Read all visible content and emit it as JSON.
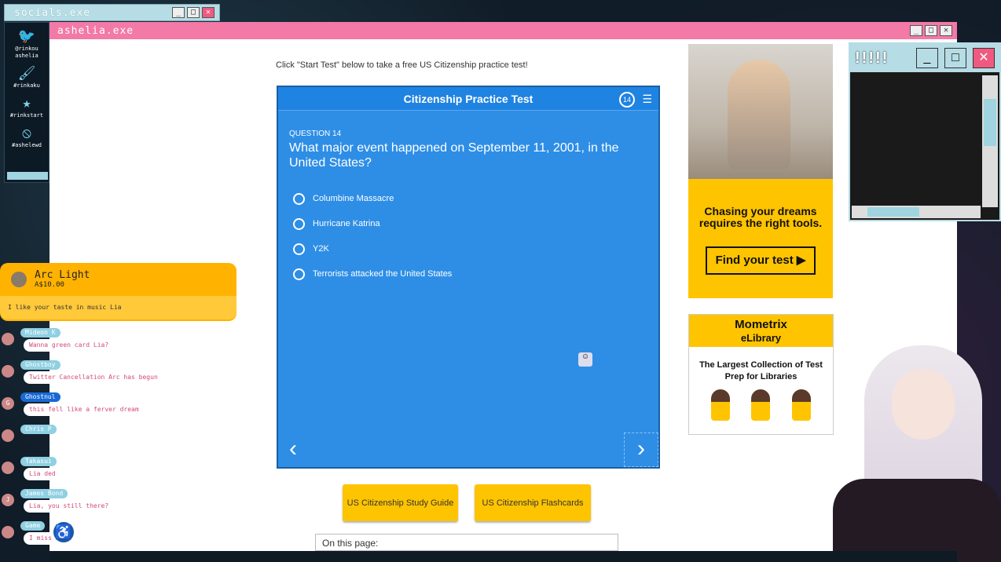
{
  "socials_window": {
    "title": "socials.exe",
    "items": [
      {
        "icon": "twitter-bird-icon",
        "glyph": "🐦",
        "label": "@rinkou\nashelia"
      },
      {
        "icon": "paintbrush-icon",
        "glyph": "🖌",
        "label": "#rinkaku"
      },
      {
        "icon": "star-icon",
        "glyph": "★",
        "label": "#rinkstart"
      },
      {
        "icon": "ban-icon",
        "glyph": "⦸",
        "label": "#ashelewd"
      }
    ]
  },
  "main_window": {
    "title": "ashelia.exe"
  },
  "page": {
    "intro": "Click \"Start Test\" below to take a free US Citizenship practice test!",
    "quiz": {
      "title": "Citizenship Practice Test",
      "question_number": "14",
      "question_label": "QUESTION 14",
      "question_text": "What major event happened on September 11, 2001, in the United States?",
      "answers": [
        "Columbine Massacre",
        "Hurricane Katrina",
        "Y2K",
        "Terrorists attacked the United States"
      ]
    },
    "buttons": {
      "study_guide": "US Citizenship Study Guide",
      "flashcards": "US Citizenship Flashcards"
    },
    "on_this_page": "On this page:",
    "ad1": {
      "text": "Chasing your dreams requires the right tools.",
      "cta": "Find your test"
    },
    "ad2": {
      "brand": "Mometrix",
      "sub": "eLibrary",
      "text": "The Largest Collection of Test Prep for Libraries"
    }
  },
  "mini_window": {
    "title": "!!!!!"
  },
  "donation": {
    "name": "Arc Light",
    "amount": "A$10.00",
    "message": "I like your taste in music Lia"
  },
  "chat": [
    {
      "name": "Mideon K",
      "message": "Wanna green card Lia?",
      "avatar": "",
      "name_style": "light"
    },
    {
      "name": "Ghostboy",
      "message": "Twitter Cancellation Arc has begun",
      "avatar": "",
      "name_style": "light"
    },
    {
      "name": "Ghostnul",
      "message": "this fell like a ferver dream",
      "avatar": "G",
      "name_style": "blue"
    },
    {
      "name": "Chris P",
      "message": "",
      "avatar": "",
      "name_style": "light"
    },
    {
      "name": "Takasui",
      "message": "Lia ded",
      "avatar": "",
      "name_style": "light"
    },
    {
      "name": "James Bond",
      "message": "Lia, you still there?",
      "avatar": "J",
      "name_style": "light"
    },
    {
      "name": "Game",
      "message": "I miss Lia",
      "avatar": "",
      "name_style": "light"
    }
  ],
  "colors": {
    "quiz_blue": "#2e8ee6",
    "brand_yellow": "#ffc400",
    "window_pink": "#f379a6",
    "window_cyan": "#b6dce5"
  }
}
